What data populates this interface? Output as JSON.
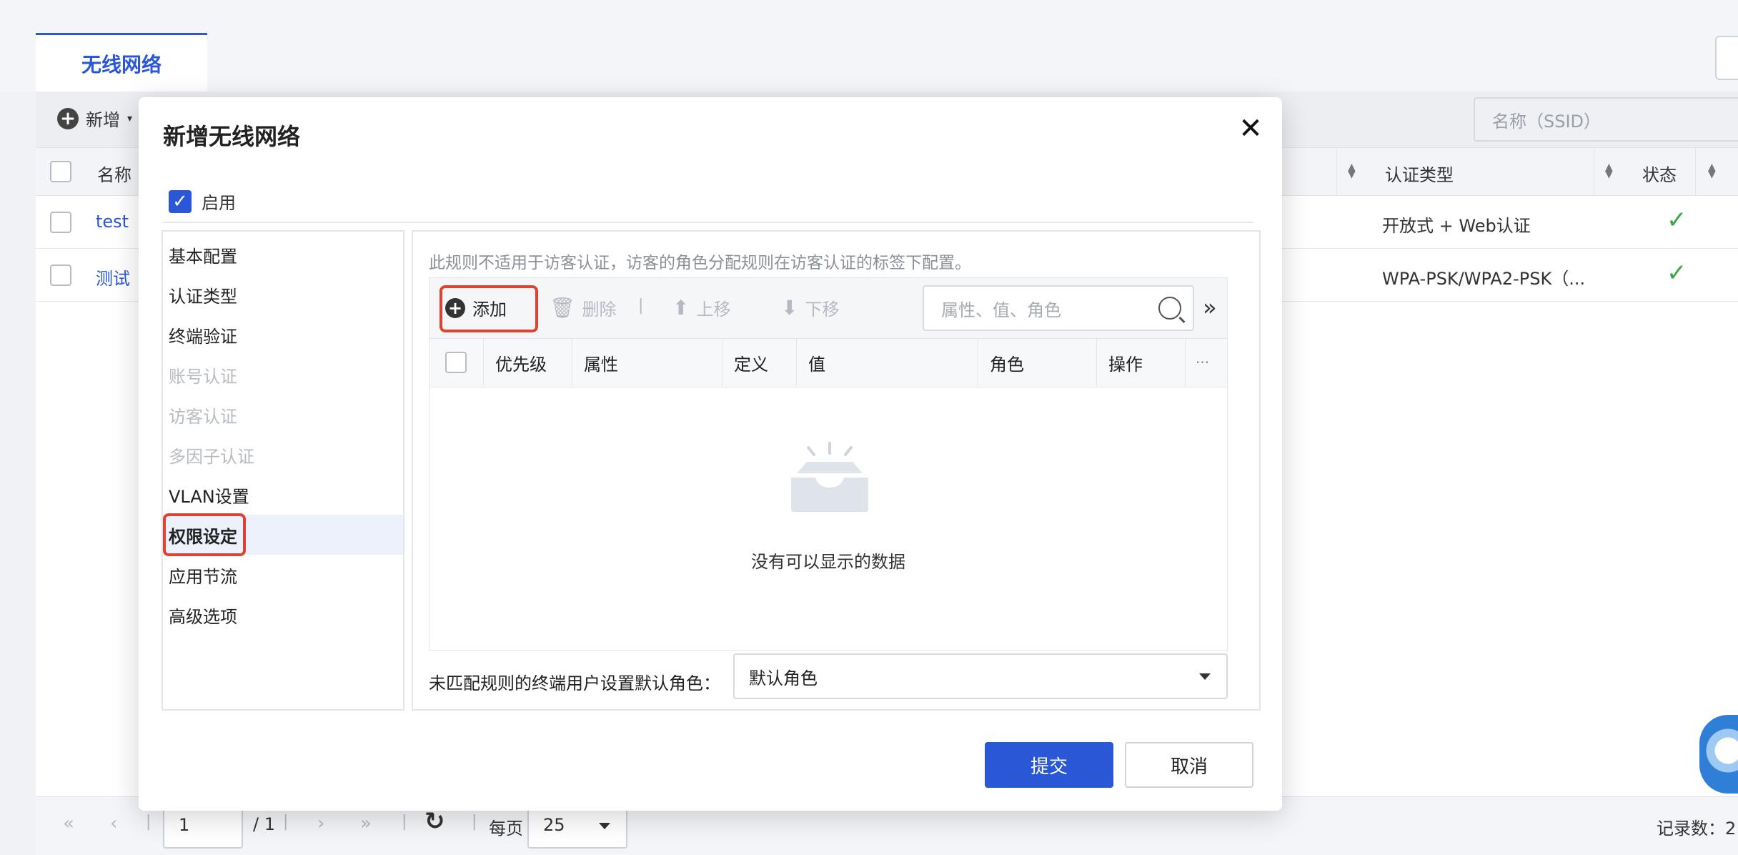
{
  "tabs": [
    {
      "label": "无线网络",
      "active": true
    }
  ],
  "toolbar": {
    "new_label": "新增",
    "search_placeholder": "名称（SSID）"
  },
  "table": {
    "headers": {
      "name": "名称",
      "auth_type": "认证类型",
      "status": "状态"
    },
    "rows": [
      {
        "name": "test",
        "auth_type": "开放式 + Web认证",
        "status": "enabled"
      },
      {
        "name": "测试",
        "auth_type": "WPA-PSK/WPA2-PSK（...",
        "status": "enabled"
      }
    ]
  },
  "pagination": {
    "page": "1",
    "total_pages": "/ 1",
    "per_page_label": "每页",
    "per_page": "25",
    "record_label": "记录数：2"
  },
  "modal": {
    "title": "新增无线网络",
    "enable_label": "启用",
    "nav": [
      {
        "label": "基本配置",
        "state": "normal"
      },
      {
        "label": "认证类型",
        "state": "normal"
      },
      {
        "label": "终端验证",
        "state": "normal"
      },
      {
        "label": "账号认证",
        "state": "disabled"
      },
      {
        "label": "访客认证",
        "state": "disabled"
      },
      {
        "label": "多因子认证",
        "state": "disabled"
      },
      {
        "label": "VLAN设置",
        "state": "normal"
      },
      {
        "label": "权限设定",
        "state": "active"
      },
      {
        "label": "应用节流",
        "state": "normal"
      },
      {
        "label": "高级选项",
        "state": "normal"
      }
    ],
    "hint": "此规则不适用于访客认证，访客的角色分配规则在访客认证的标签下配置。",
    "rule_toolbar": {
      "add": "添加",
      "delete": "删除",
      "move_up": "上移",
      "move_down": "下移",
      "search_placeholder": "属性、值、角色"
    },
    "rule_columns": [
      "优先级",
      "属性",
      "定义",
      "值",
      "角色",
      "操作"
    ],
    "more_cols": "···",
    "empty_text": "没有可以显示的数据",
    "default_role_label": "未匹配规则的终端用户设置默认角色：",
    "default_role_value": "默认角色",
    "submit": "提交",
    "cancel": "取消"
  },
  "colors": {
    "accent": "#2a57d6",
    "highlight": "#e0422f",
    "success": "#3aa84a"
  }
}
